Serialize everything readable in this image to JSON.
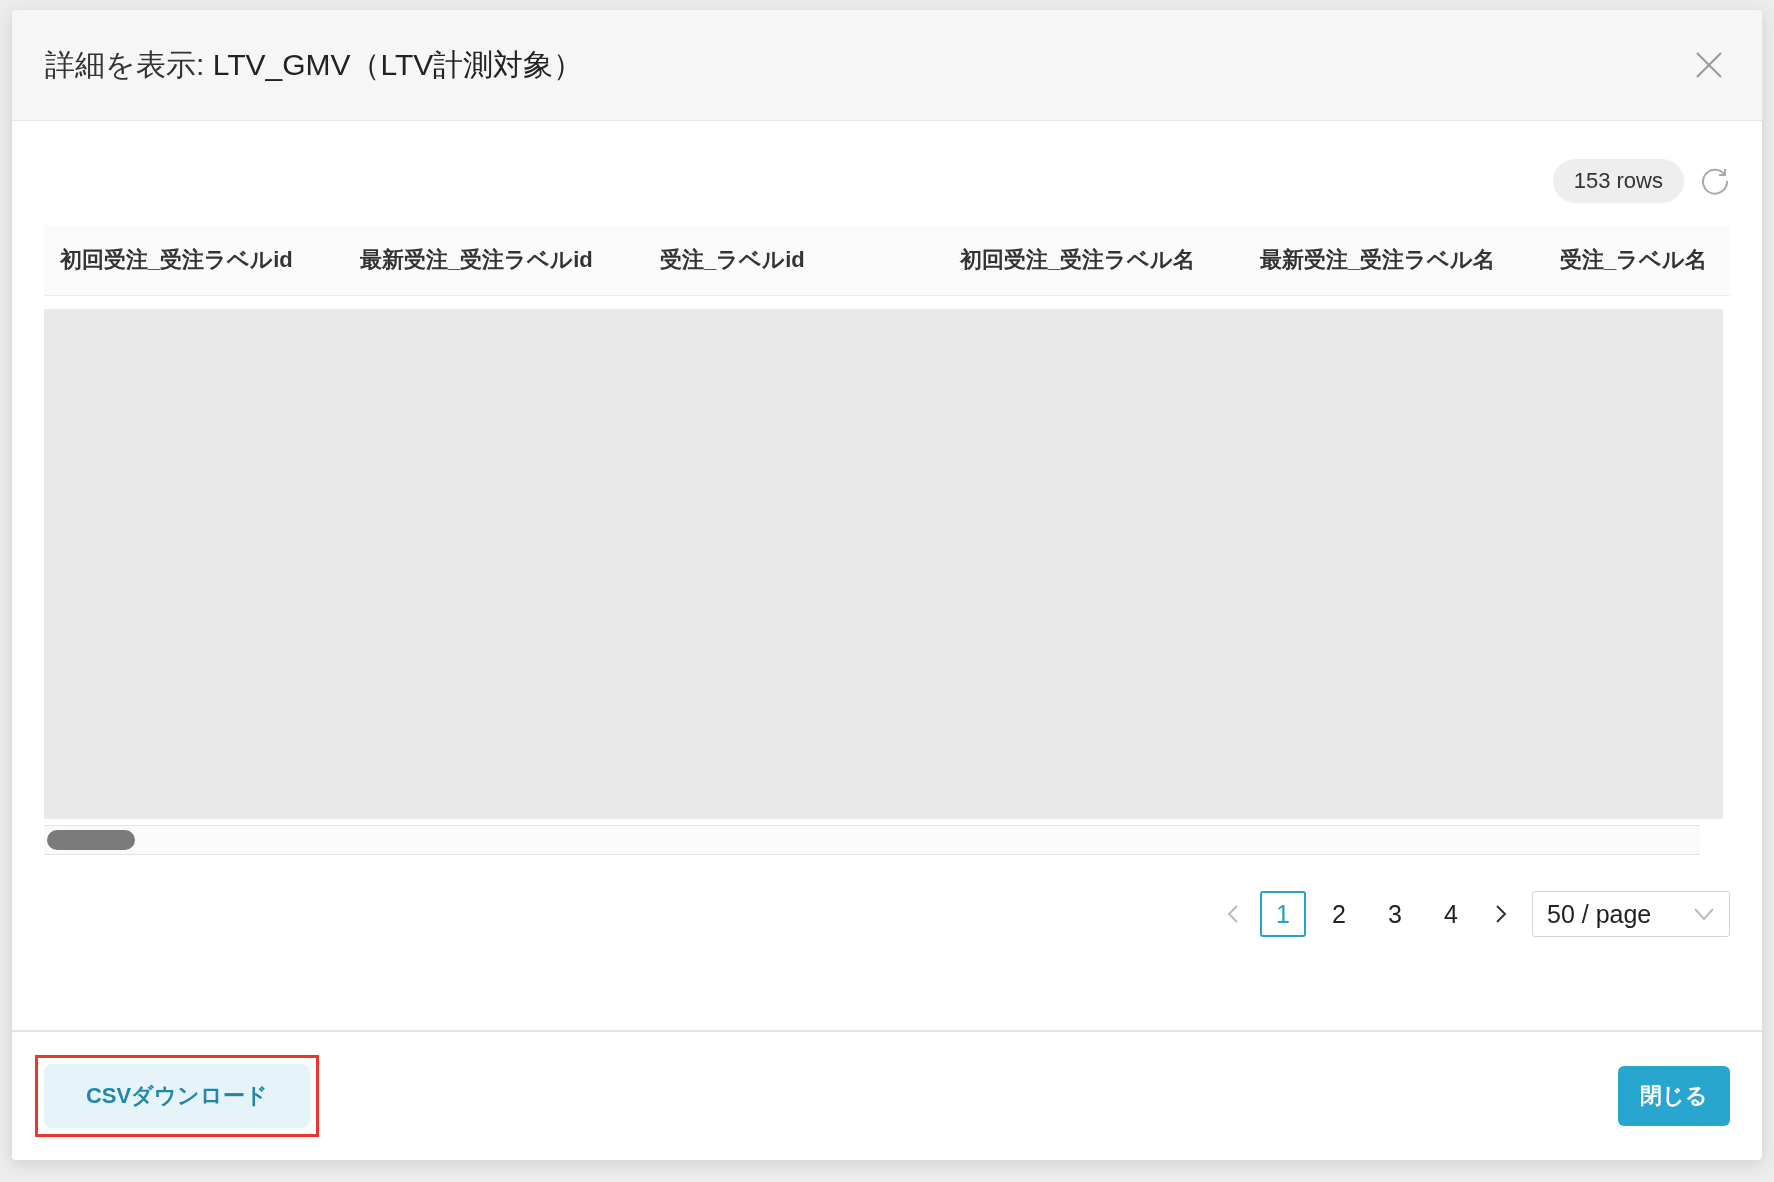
{
  "dialog": {
    "title_prefix": "詳細を表示: ",
    "title_name": "LTV_GMV（LTV計測対象）"
  },
  "row_count": "153 rows",
  "table": {
    "columns": [
      "初回受注_受注ラベルid",
      "最新受注_受注ラベルid",
      "受注_ラベルid",
      "初回受注_受注ラベル名",
      "最新受注_受注ラベル名",
      "受注_ラベル名"
    ],
    "loading": true
  },
  "pagination": {
    "pages": [
      {
        "label": "1",
        "selected": true
      },
      {
        "label": "2",
        "selected": false
      },
      {
        "label": "3",
        "selected": false
      },
      {
        "label": "4",
        "selected": false
      }
    ],
    "page_size": "50 / page"
  },
  "footer": {
    "csv_button": {
      "label": "CSVダウンロード",
      "highlighted": true
    },
    "close_button": {
      "label": "閉じる"
    }
  }
}
